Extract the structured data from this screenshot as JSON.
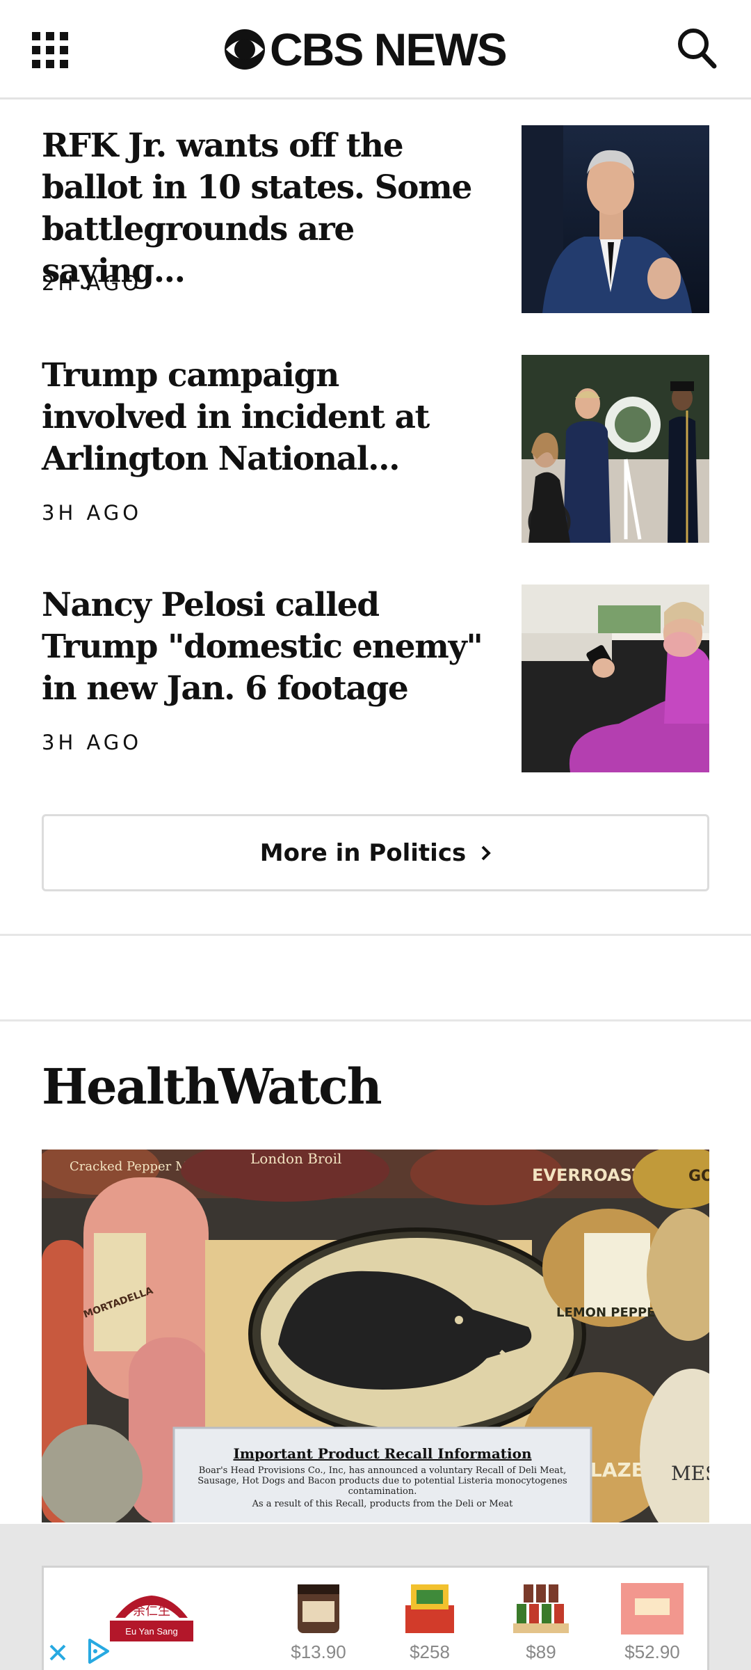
{
  "header": {
    "brand": "CBS NEWS",
    "menu_icon": "grid-menu-icon",
    "search_icon": "search-icon"
  },
  "politics": {
    "stories": [
      {
        "headline": "RFK Jr. wants off the ballot in 10 states. Some battlegrounds are saying...",
        "ago": "2H AGO"
      },
      {
        "headline": "Trump campaign involved in incident at Arlington National...",
        "ago": "3H AGO"
      },
      {
        "headline": "Nancy Pelosi called Trump \"domestic enemy\" in new Jan. 6 footage",
        "ago": "3H AGO"
      }
    ],
    "more_label": "More in Politics"
  },
  "healthwatch": {
    "title": "HealthWatch",
    "sign_title": "Important Product Recall Information",
    "sign_text": "Boar's Head Provisions Co., Inc, has announced a voluntary Recall of Deli Meat, Sausage, Hot Dogs and Bacon products due to potential Listeria monocytogenes contamination.",
    "sign_text2": "As a result of this Recall, products from the Deli or Meat",
    "labels": [
      "Cracked Pepper Mill",
      "London Broil",
      "EVERROAST",
      "GOLD",
      "MORTADELLA",
      "LEMON PEPPER",
      "GLAZED COAT",
      "MES WOO"
    ]
  },
  "ad": {
    "brand_name": "Eu Yan Sang",
    "prices": [
      "$13.90",
      "$258",
      "$89",
      "$52.90"
    ],
    "colors": {
      "brand": "#b3172a",
      "price": "#888888",
      "adchoice": "#27a9e1"
    }
  }
}
